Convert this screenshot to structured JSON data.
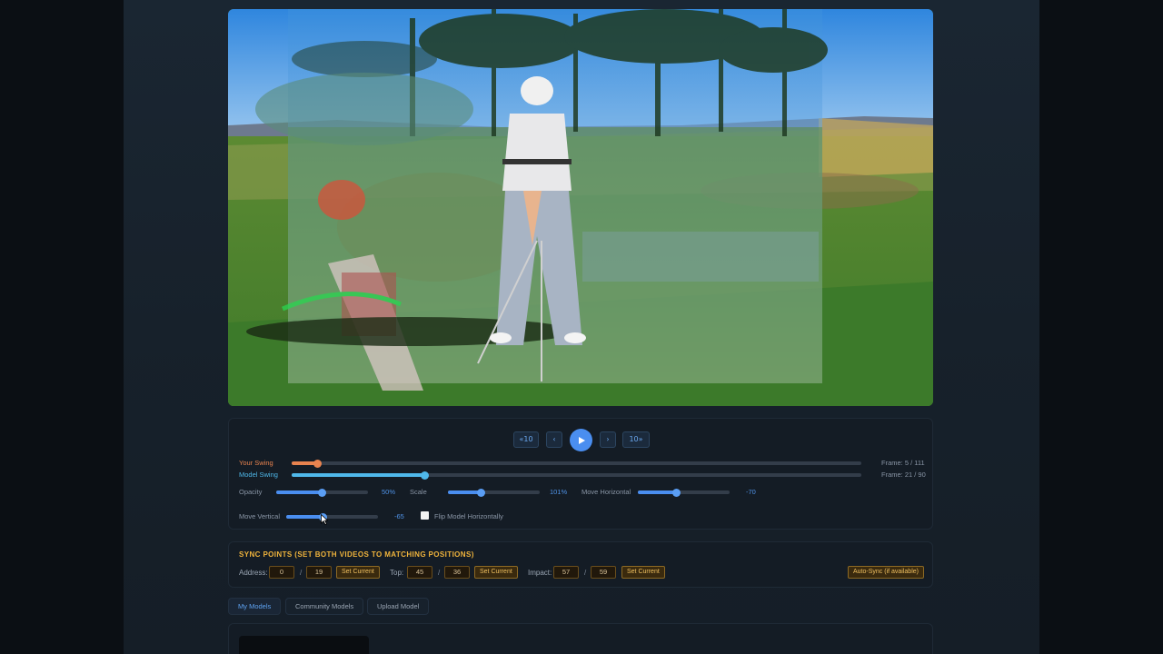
{
  "playback": {
    "back10": "«10",
    "prev": "‹",
    "next": "›",
    "fwd10": "10»"
  },
  "tracks": {
    "your_swing": {
      "label": "Your Swing",
      "frame_text": "Frame: 5 / 111",
      "current": 5,
      "total": 111,
      "color": "#e8834f"
    },
    "model_swing": {
      "label": "Model Swing",
      "frame_text": "Frame: 21 / 90",
      "current": 21,
      "total": 90,
      "color": "#4fb8ea"
    }
  },
  "sliders": {
    "opacity": {
      "label": "Opacity",
      "value": "50%",
      "level": 0.5
    },
    "scale": {
      "label": "Scale",
      "value": "101%",
      "level": 0.36
    },
    "move_horizontal": {
      "label": "Move Horizontal",
      "value": "-70",
      "level": 0.42
    },
    "move_vertical": {
      "label": "Move Vertical",
      "value": "-65",
      "level": 0.4
    }
  },
  "flip": {
    "label": "Flip Model Horizontally",
    "checked": false
  },
  "sync": {
    "title": "SYNC POINTS (SET BOTH VIDEOS TO MATCHING POSITIONS)",
    "address": {
      "label": "Address:",
      "a": "0",
      "b": "19"
    },
    "top": {
      "label": "Top:",
      "a": "45",
      "b": "36"
    },
    "impact": {
      "label": "Impact:",
      "a": "57",
      "b": "59"
    },
    "set_current": "Set Current",
    "auto_sync": "Auto-Sync (if available)",
    "separator": "/"
  },
  "tabs": [
    "My Models",
    "Community Models",
    "Upload Model"
  ],
  "colors": {
    "accent": "#4a8ef0",
    "sync_accent": "#f0b43c"
  }
}
